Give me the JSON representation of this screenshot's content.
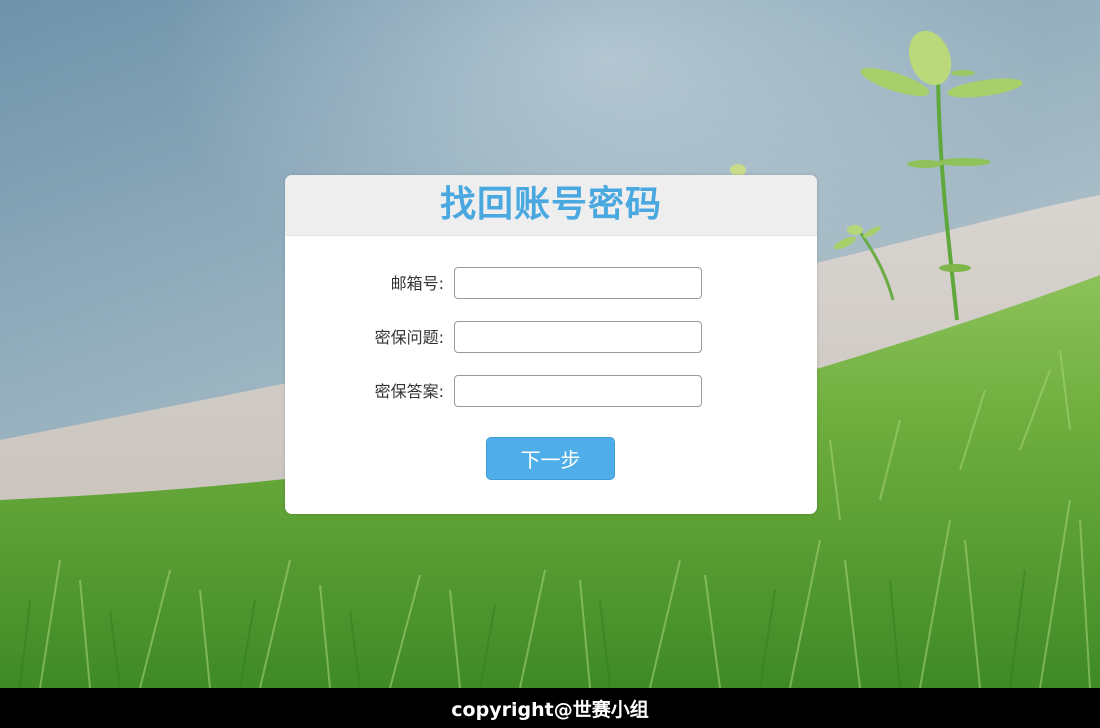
{
  "form": {
    "title": "找回账号密码",
    "fields": [
      {
        "label": "邮箱号:",
        "value": "",
        "placeholder": ""
      },
      {
        "label": "密保问题:",
        "value": "",
        "placeholder": ""
      },
      {
        "label": "密保答案:",
        "value": "",
        "placeholder": ""
      }
    ],
    "next_label": "下一步"
  },
  "footer": {
    "text": "copyright@世赛小组"
  },
  "colors": {
    "accent": "#4aa8e0",
    "button": "#4faee8",
    "footer_bg": "#000000",
    "header_bg": "#eeeeee"
  }
}
